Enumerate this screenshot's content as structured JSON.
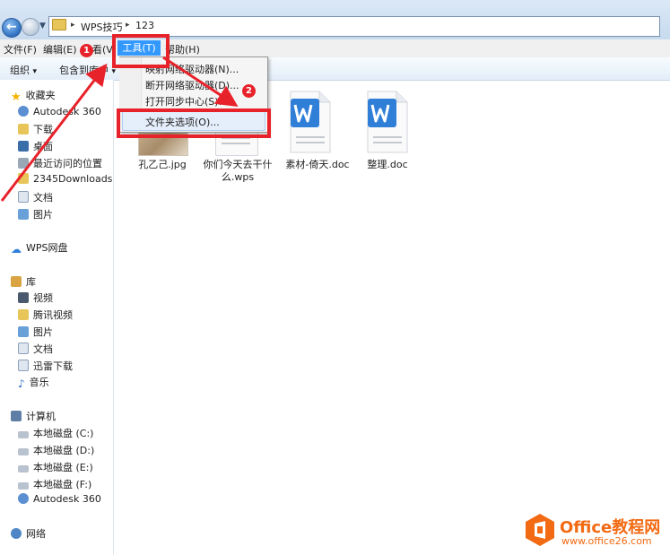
{
  "address": {
    "crumbs": [
      "WPS技巧",
      "123"
    ],
    "separator": "▸"
  },
  "menubar": {
    "items": [
      "文件(F)",
      "编辑(E)",
      "查看(V)",
      "工具(T)",
      "帮助(H)"
    ],
    "visible_fragments": {
      "view": "看(V",
      "help": "帮助(H)"
    }
  },
  "toolbar": {
    "organize": "组织",
    "include_in_library": "包含到库中",
    "dropdown_arrow": "▾"
  },
  "tools_menu": {
    "items": [
      "映射网络驱动器(N)...",
      "断开网络驱动器(D)...",
      "打开同步中心(S)...",
      "文件夹选项(O)..."
    ],
    "highlighted_index": 3
  },
  "annotations": {
    "step1": "1",
    "step2": "2",
    "colors": {
      "highlight": "#e8222a",
      "menu_selected": "#3399ff"
    }
  },
  "navigation": {
    "favorites": {
      "label": "收藏夹",
      "items": [
        "Autodesk 360",
        "下载",
        "桌面",
        "最近访问的位置",
        "2345Downloads",
        "文档",
        "图片"
      ]
    },
    "cloud": {
      "label": "WPS网盘"
    },
    "libraries": {
      "label": "库",
      "items": [
        "视频",
        "腾讯视频",
        "图片",
        "文档",
        "迅雷下载",
        "音乐"
      ]
    },
    "computer": {
      "label": "计算机",
      "items": [
        "本地磁盘 (C:)",
        "本地磁盘 (D:)",
        "本地磁盘 (E:)",
        "本地磁盘 (F:)",
        "Autodesk 360"
      ]
    },
    "network": {
      "label": "网络"
    }
  },
  "files": [
    {
      "name": "孔乙己.jpg",
      "icon": "image-thumbnail"
    },
    {
      "name_line1": "你们今天去干什",
      "name_line2": "么.wps",
      "icon": "wps-document-icon"
    },
    {
      "name": "素材-倚天.doc",
      "icon": "wps-writer-icon"
    },
    {
      "name": "整理.doc",
      "icon": "wps-writer-icon"
    }
  ],
  "watermark": {
    "title": "Office教程网",
    "url": "www.office26.com"
  }
}
